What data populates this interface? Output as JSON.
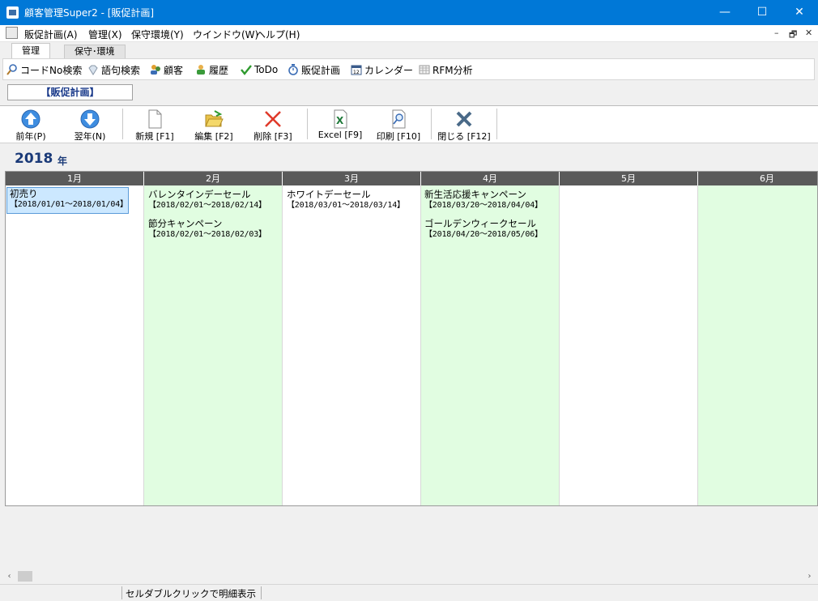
{
  "window": {
    "title": "顧客管理Super2 - [販促計画]",
    "minimize": "—",
    "maximize": "☐",
    "close": "✕"
  },
  "menubar": {
    "items": [
      "販促計画(A)",
      "管理(X)",
      "保守環境(Y)",
      "ウインドウ(W)",
      "ヘルプ(H)"
    ],
    "mdi_controls": [
      "–",
      "🗗",
      "✕"
    ]
  },
  "tabs": [
    {
      "label": "管理",
      "active": true
    },
    {
      "label": "保守･環境",
      "active": false
    }
  ],
  "ribbon": [
    {
      "label": "コードNo検索",
      "icon": "search-icon"
    },
    {
      "label": "語句検索",
      "icon": "diamond-icon"
    },
    {
      "label": "顧客",
      "icon": "customers-icon"
    },
    {
      "label": "履歴",
      "icon": "history-icon"
    },
    {
      "label": "ToDo",
      "icon": "check-icon"
    },
    {
      "label": "販促計画",
      "icon": "stopwatch-icon"
    },
    {
      "label": "カレンダー",
      "icon": "calendar-icon"
    },
    {
      "label": "RFM分析",
      "icon": "grid-icon"
    }
  ],
  "header_label": "【販促計画】",
  "toolbar": [
    {
      "label": "前年(P)",
      "icon": "up-arrow-icon"
    },
    {
      "label": "翌年(N)",
      "icon": "down-arrow-icon"
    },
    {
      "label": "新規 [F1]",
      "icon": "new-document-icon"
    },
    {
      "label": "編集 [F2]",
      "icon": "open-folder-icon"
    },
    {
      "label": "削除 [F3]",
      "icon": "delete-x-icon"
    },
    {
      "label": "Excel [F9]",
      "icon": "excel-icon"
    },
    {
      "label": "印刷 [F10]",
      "icon": "print-preview-icon"
    },
    {
      "label": "閉じる [F12]",
      "icon": "close-x-icon"
    }
  ],
  "calendar": {
    "year": "2018",
    "year_unit": "年",
    "months": [
      {
        "label": "1月",
        "events": [
          {
            "name": "初売り",
            "dates": "【2018/01/01～2018/01/04】",
            "selected": true
          }
        ]
      },
      {
        "label": "2月",
        "events": [
          {
            "name": "バレンタインデーセール",
            "dates": "【2018/02/01～2018/02/14】"
          },
          {
            "name": "節分キャンペーン",
            "dates": "【2018/02/01～2018/02/03】"
          }
        ]
      },
      {
        "label": "3月",
        "events": [
          {
            "name": "ホワイトデーセール",
            "dates": "【2018/03/01～2018/03/14】"
          }
        ]
      },
      {
        "label": "4月",
        "events": [
          {
            "name": "新生活応援キャンペーン",
            "dates": "【2018/03/20～2018/04/04】"
          },
          {
            "name": "ゴールデンウィークセール",
            "dates": "【2018/04/20～2018/05/06】"
          }
        ]
      },
      {
        "label": "5月",
        "events": []
      },
      {
        "label": "6月",
        "events": []
      }
    ]
  },
  "scroll": {
    "left": "‹",
    "right": "›"
  },
  "status": {
    "text": "セルダブルクリックで明細表示"
  },
  "colors": {
    "titlebar": "#0078d7",
    "month_header": "#5a5a5a",
    "green_column": "#e1fde1",
    "selected_event": "#cce8ff"
  }
}
